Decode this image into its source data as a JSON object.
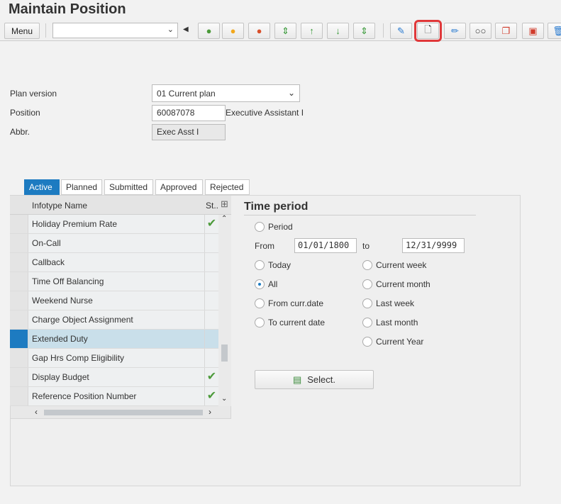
{
  "title": "Maintain Position",
  "toolbar": {
    "menu_label": "Menu",
    "command_value": "",
    "buttons": [
      "back-icon",
      "exit-icon",
      "cancel-icon",
      "first-icon",
      "previous-icon",
      "next-icon",
      "last-icon",
      "display-change-icon",
      "create-icon",
      "change-icon",
      "display-icon",
      "copy-icon",
      "delimit-icon",
      "delete-icon"
    ],
    "highlighted": "create-icon"
  },
  "form": {
    "plan_version_label": "Plan version",
    "plan_version_value": "01 Current plan",
    "position_label": "Position",
    "position_value": "60087078",
    "position_text": "Executive Assistant I",
    "abbr_label": "Abbr.",
    "abbr_value": "Exec Asst I"
  },
  "tabs": [
    "Active",
    "Planned",
    "Submitted",
    "Approved",
    "Rejected"
  ],
  "active_tab": "Active",
  "table": {
    "col_name": "Infotype Name",
    "col_status": "St..",
    "rows": [
      {
        "name": "Holiday Premium Rate",
        "status": "✔"
      },
      {
        "name": "On-Call",
        "status": ""
      },
      {
        "name": "Callback",
        "status": ""
      },
      {
        "name": "Time Off Balancing",
        "status": ""
      },
      {
        "name": "Weekend Nurse",
        "status": ""
      },
      {
        "name": "Charge Object Assignment",
        "status": ""
      },
      {
        "name": "Extended Duty",
        "status": "",
        "selected": true
      },
      {
        "name": "Gap Hrs Comp Eligibility",
        "status": ""
      },
      {
        "name": "Display Budget",
        "status": "✔"
      },
      {
        "name": "Reference Position Number",
        "status": "✔"
      }
    ]
  },
  "time_period": {
    "title": "Time period",
    "period": "Period",
    "from_label": "From",
    "from_value": "01/01/1800",
    "to_label": "to",
    "to_value": "12/31/9999",
    "today": "Today",
    "all": "All",
    "from_curr": "From curr.date",
    "to_curr": "To current date",
    "current_week": "Current week",
    "current_month": "Current month",
    "last_week": "Last week",
    "last_month": "Last month",
    "current_year": "Current Year",
    "selected": "All",
    "select_button": "Select."
  },
  "colors": {
    "accent": "#1d7bc1",
    "highlight": "#e0383a",
    "check": "#4c9a3a"
  }
}
